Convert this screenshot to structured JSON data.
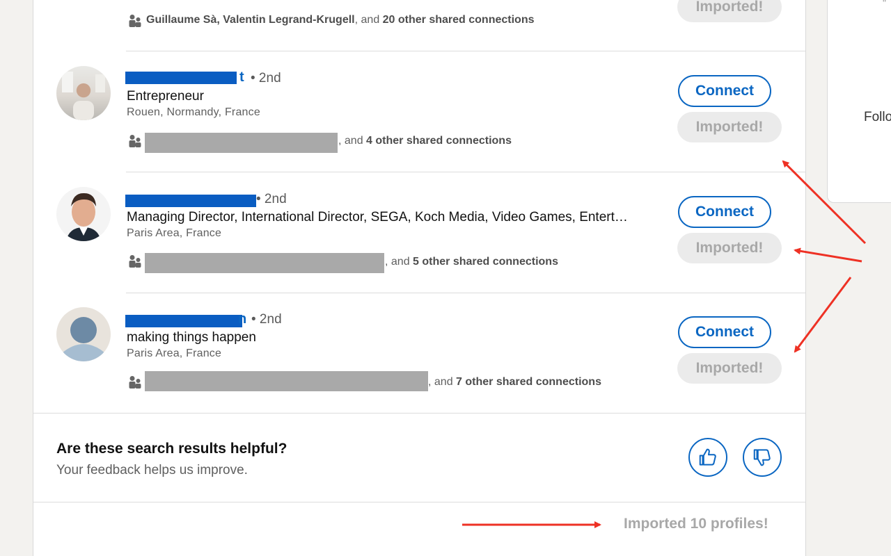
{
  "top_row": {
    "shared_names": "Guillaume Sà, Valentin Legrand-Krugell",
    "shared_mid": ", and ",
    "shared_count": "20 other shared connections",
    "imported_label": "Imported!"
  },
  "results": [
    {
      "name_tail": "t",
      "degree": "• 2nd",
      "headline": "Entrepreneur",
      "location": "Rouen, Normandy, France",
      "shared_prefix": ", and ",
      "shared_count": "4 other shared connections",
      "connect_label": "Connect",
      "imported_label": "Imported!"
    },
    {
      "name_tail": "",
      "degree": "• 2nd",
      "headline": "Managing Director, International Director, SEGA, Koch Media, Video Games, Entert…",
      "location": "Paris Area, France",
      "shared_prefix": ", and ",
      "shared_count": "5 other shared connections",
      "connect_label": "Connect",
      "imported_label": "Imported!"
    },
    {
      "name_tail": "n",
      "degree": "• 2nd",
      "headline": "making things happen",
      "location": "Paris Area, France",
      "shared_prefix": ", and ",
      "shared_count": "7 other shared connections",
      "connect_label": "Connect",
      "imported_label": "Imported!"
    }
  ],
  "feedback": {
    "title": "Are these search results helpful?",
    "subtitle": "Your feedback helps us improve."
  },
  "footer": {
    "imported_count": "Imported 10 profiles!"
  },
  "sidebar": {
    "label": "Follo"
  },
  "icons": {
    "people": "people-icon",
    "thumbs_up": "thumbs-up-icon",
    "thumbs_down": "thumbs-down-icon"
  },
  "colors": {
    "link": "#0a66c2",
    "imported_text": "#a8a8a8",
    "annotation_arrow": "#ee3124"
  }
}
